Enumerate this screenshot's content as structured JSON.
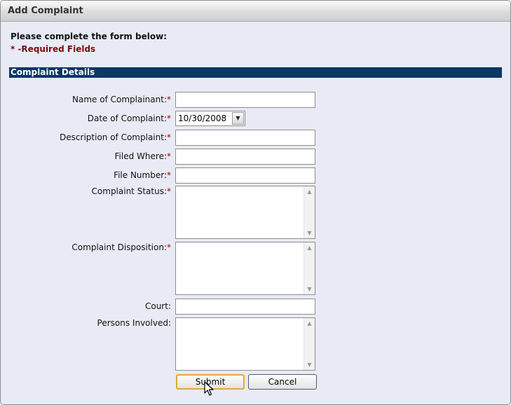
{
  "window": {
    "title": "Add Complaint"
  },
  "intro": {
    "instruction": "Please complete the form below:",
    "required_note": "* -Required Fields"
  },
  "section": {
    "title": "Complaint Details"
  },
  "fields": {
    "name_of_complainant": {
      "label": "Name of Complainant:",
      "required": "*",
      "value": ""
    },
    "date_of_complaint": {
      "label": "Date of Complaint:",
      "required": "*",
      "value": "10/30/2008"
    },
    "description_of_complaint": {
      "label": "Description of Complaint:",
      "required": "*",
      "value": ""
    },
    "filed_where": {
      "label": "Filed Where:",
      "required": "*",
      "value": ""
    },
    "file_number": {
      "label": "File Number:",
      "required": "*",
      "value": ""
    },
    "complaint_status": {
      "label": "Complaint Status:",
      "required": "*",
      "value": ""
    },
    "complaint_disposition": {
      "label": "Complaint Disposition:",
      "required": "*",
      "value": ""
    },
    "court": {
      "label": "Court:",
      "value": ""
    },
    "persons_involved": {
      "label": "Persons Involved:",
      "value": ""
    }
  },
  "buttons": {
    "submit": "Submit",
    "cancel": "Cancel"
  },
  "icons": {
    "dropdown": "chevron-down-icon",
    "scroll_up": "arrow-up-icon",
    "scroll_down": "arrow-down-icon",
    "cursor": "mouse-pointer-icon"
  },
  "colors": {
    "section_bar": "#0c3766",
    "required": "#a00000",
    "required_note": "#7a0c0c",
    "submit_focus": "#e0a936",
    "window_bg": "#e8ebf5"
  }
}
